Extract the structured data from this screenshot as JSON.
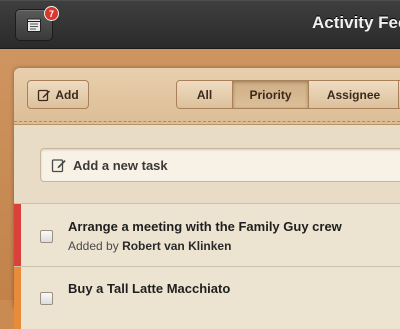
{
  "header": {
    "title": "Activity Feed",
    "notification_count": "7"
  },
  "toolbar": {
    "add_label": "Add",
    "filters": [
      "All",
      "Priority",
      "Assignee"
    ],
    "active_filter": "Priority"
  },
  "new_task": {
    "placeholder": "Add a new task"
  },
  "tasks": [
    {
      "title": "Arrange a meeting with the Family Guy crew",
      "added_by_prefix": "Added by",
      "added_by": "Robert van Klinken",
      "priority_color": "#d9413a"
    },
    {
      "title": "Buy a Tall Latte Macchiato",
      "priority_color": "#e88b3a"
    }
  ],
  "colors": {
    "topbar": "#2f2f2f",
    "leather": "#c98b52",
    "card": "#e9dcc7",
    "badge": "#d8372e"
  }
}
